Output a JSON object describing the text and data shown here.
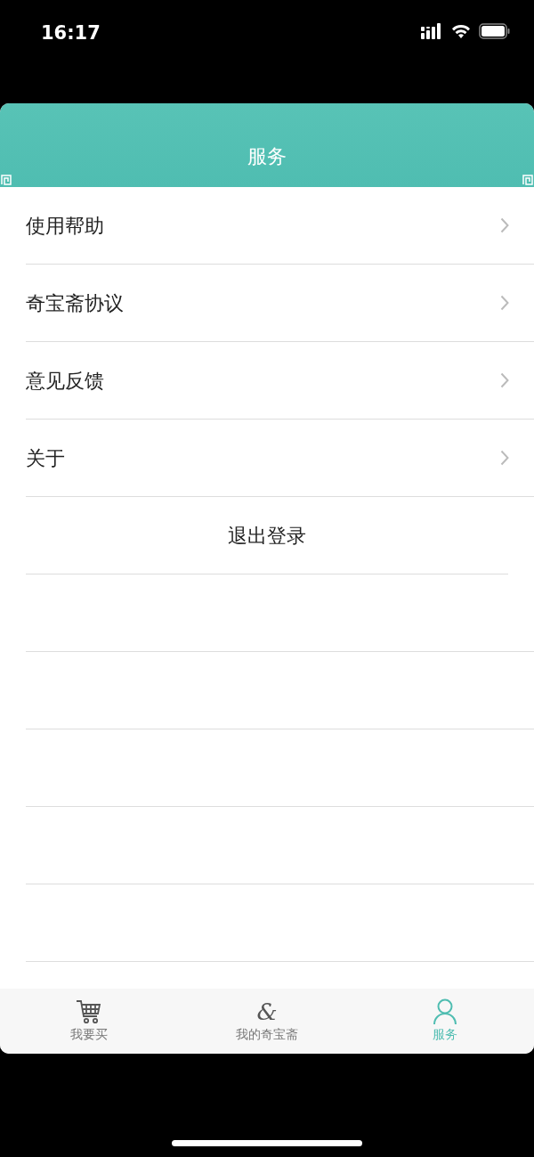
{
  "status_bar": {
    "time": "16:17"
  },
  "header": {
    "title": "服务"
  },
  "menu": [
    {
      "label": "使用帮助",
      "kind": "link"
    },
    {
      "label": "奇宝斋协议",
      "kind": "link"
    },
    {
      "label": "意见反馈",
      "kind": "link"
    },
    {
      "label": "关于",
      "kind": "link"
    },
    {
      "label": "退出登录",
      "kind": "action"
    }
  ],
  "tab_bar": [
    {
      "label": "我要买",
      "kind": "cart",
      "selected": false
    },
    {
      "label": "我的奇宝斋",
      "kind": "glyph",
      "glyph": "&",
      "selected": false
    },
    {
      "label": "服务",
      "kind": "person",
      "selected": true
    }
  ]
}
